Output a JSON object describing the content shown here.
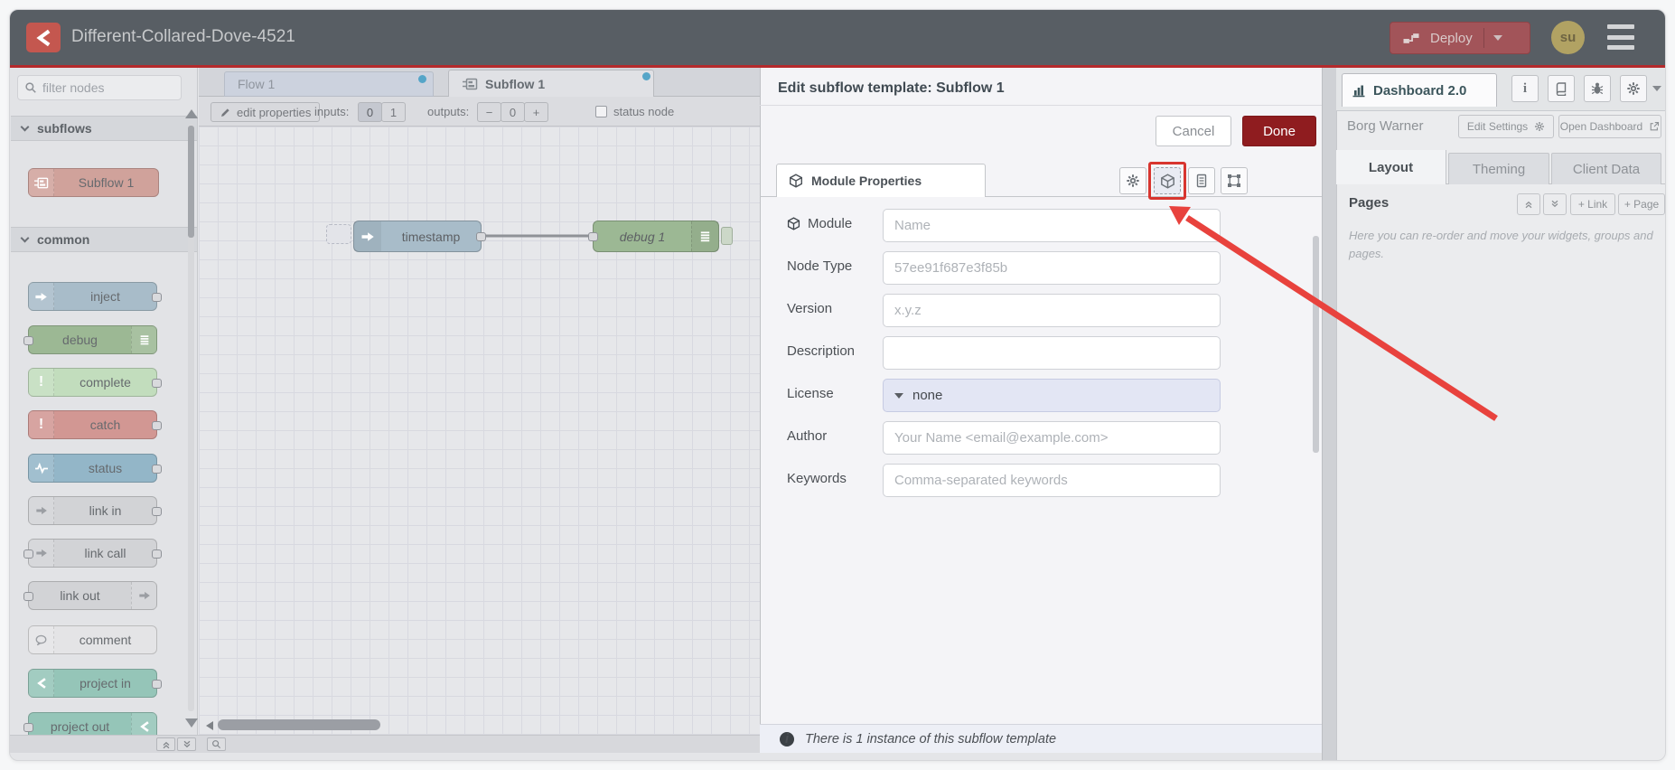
{
  "header": {
    "title": "Different-Collared-Dove-4521",
    "deploy_label": "Deploy",
    "avatar_initials": "su"
  },
  "palette": {
    "filter_placeholder": "filter nodes",
    "section_subflows": "subflows",
    "section_common": "common",
    "subflow_nodes": [
      {
        "label": "Subflow 1"
      }
    ],
    "common_nodes": [
      {
        "label": "inject"
      },
      {
        "label": "debug"
      },
      {
        "label": "complete"
      },
      {
        "label": "catch"
      },
      {
        "label": "status"
      },
      {
        "label": "link in"
      },
      {
        "label": "link call"
      },
      {
        "label": "link out"
      },
      {
        "label": "comment"
      },
      {
        "label": "project in"
      },
      {
        "label": "project out"
      }
    ]
  },
  "tabs": {
    "flow1": "Flow 1",
    "subflow1": "Subflow 1"
  },
  "toolbar": {
    "edit_properties": "edit properties",
    "inputs_label": "inputs:",
    "input_0": "0",
    "input_1": "1",
    "outputs_label": "outputs:",
    "output_minus": "−",
    "output_value": "0",
    "output_plus": "+",
    "status_node": "status node"
  },
  "canvas": {
    "node_timestamp": "timestamp",
    "node_debug": "debug 1"
  },
  "dialog": {
    "title": "Edit subflow template: Subflow 1",
    "cancel": "Cancel",
    "done": "Done",
    "tab": "Module Properties",
    "fields": {
      "module": {
        "label": "Module",
        "placeholder": "Name"
      },
      "node_type": {
        "label": "Node Type",
        "placeholder": "57ee91f687e3f85b"
      },
      "version": {
        "label": "Version",
        "placeholder": "x.y.z"
      },
      "description": {
        "label": "Description",
        "placeholder": ""
      },
      "license": {
        "label": "License",
        "value": "none"
      },
      "author": {
        "label": "Author",
        "placeholder": "Your Name <email@example.com>"
      },
      "keywords": {
        "label": "Keywords",
        "placeholder": "Comma-separated keywords"
      }
    },
    "footer_note": "There is 1 instance of this subflow template"
  },
  "sidebar": {
    "dashboard_tab": "Dashboard 2.0",
    "project_name": "Borg Warner",
    "edit_settings": "Edit Settings",
    "open_dashboard": "Open Dashboard",
    "tab_layout": "Layout",
    "tab_theming": "Theming",
    "tab_client_data": "Client Data",
    "pages_title": "Pages",
    "link_btn": "+ Link",
    "page_btn": "+ Page",
    "help": "Here you can re-order and move your widgets, groups and pages."
  },
  "colors": {
    "header_bg": "#585e64",
    "deploy_red": "#a25459",
    "done_red": "#8f1c1f",
    "annotation_red": "#e8423d",
    "modified_dot": "#55a5c8"
  }
}
